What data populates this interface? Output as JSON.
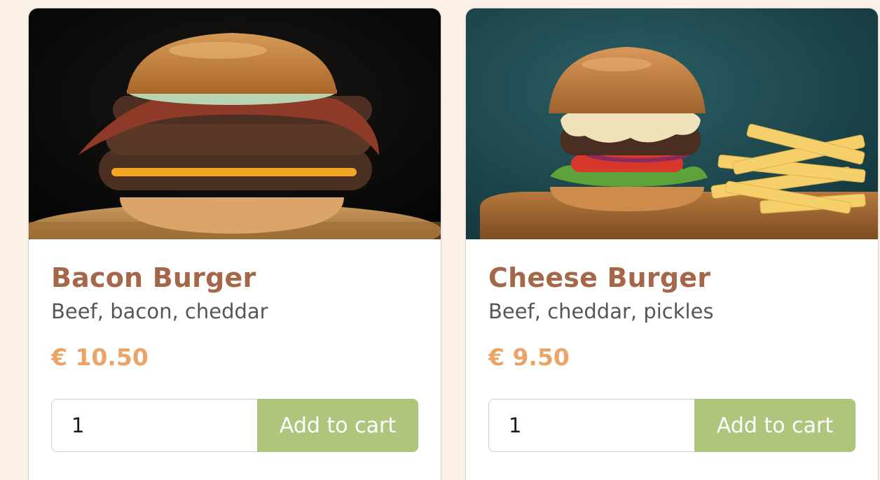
{
  "products": [
    {
      "name": "Bacon Burger",
      "description": "Beef, bacon, cheddar",
      "price": "€ 10.50",
      "quantity": "1",
      "button_label": "Add to cart",
      "image": "bacon-burger-photo"
    },
    {
      "name": "Cheese Burger",
      "description": "Beef, cheddar, pickles",
      "price": "€ 9.50",
      "quantity": "1",
      "button_label": "Add to cart",
      "image": "cheese-burger-photo"
    }
  ],
  "colors": {
    "background": "#fcf1e7",
    "title": "#a5674a",
    "price": "#eba468",
    "button": "#afc57b"
  }
}
